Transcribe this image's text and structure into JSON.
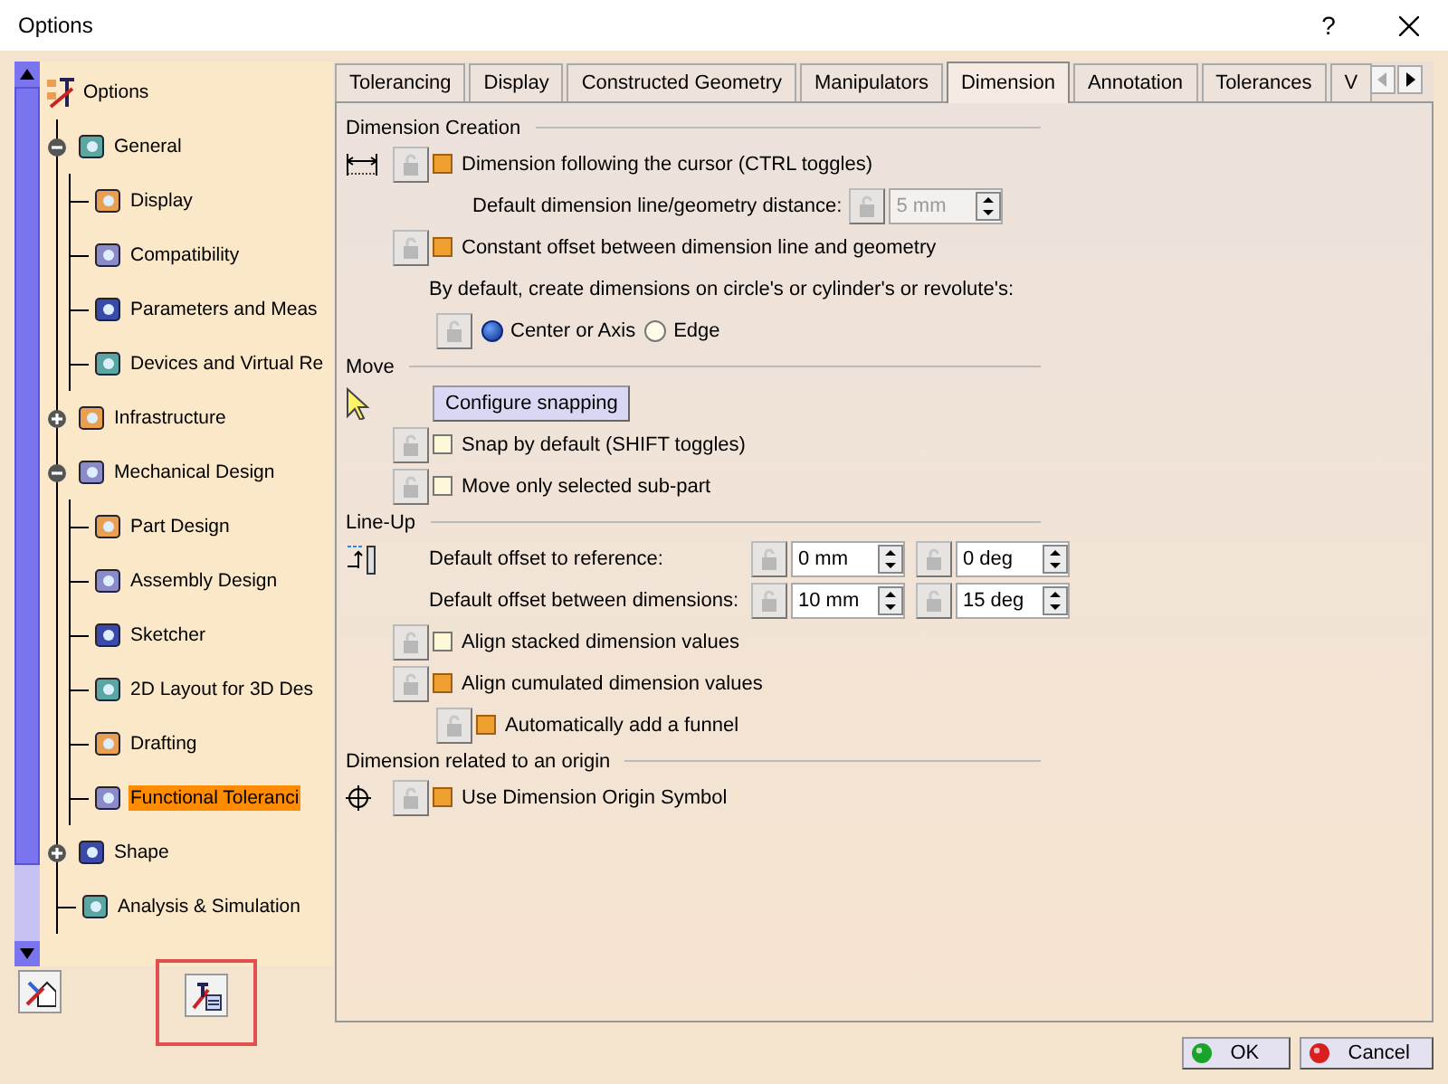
{
  "window": {
    "title": "Options",
    "help": "?"
  },
  "tree": {
    "label": "Options",
    "selected": false,
    "children": [
      {
        "label": "General",
        "expanded": true,
        "selected": false,
        "children": [
          {
            "label": "Display",
            "selected": false
          },
          {
            "label": "Compatibility",
            "selected": false
          },
          {
            "label": "Parameters and Meas",
            "selected": false
          },
          {
            "label": "Devices and Virtual Re",
            "selected": false
          }
        ]
      },
      {
        "label": "Infrastructure",
        "expanded": false,
        "selected": false
      },
      {
        "label": "Mechanical Design",
        "expanded": true,
        "selected": false,
        "children": [
          {
            "label": "Part Design",
            "selected": false
          },
          {
            "label": "Assembly Design",
            "selected": false
          },
          {
            "label": "Sketcher",
            "selected": false
          },
          {
            "label": "2D Layout for 3D Des",
            "selected": false
          },
          {
            "label": "Drafting",
            "selected": false
          },
          {
            "label": "Functional Toleranci",
            "selected": true
          }
        ]
      },
      {
        "label": "Shape",
        "expanded": false,
        "selected": false
      },
      {
        "label": "Analysis & Simulation",
        "selected": false
      }
    ]
  },
  "tabs": [
    {
      "label": "Tolerancing",
      "selected": false
    },
    {
      "label": "Display",
      "selected": false
    },
    {
      "label": "Constructed Geometry",
      "selected": false
    },
    {
      "label": "Manipulators",
      "selected": false
    },
    {
      "label": "Dimension",
      "selected": true
    },
    {
      "label": "Annotation",
      "selected": false
    },
    {
      "label": "Tolerances",
      "selected": false
    },
    {
      "label": "V",
      "selected": false
    }
  ],
  "sections": [
    {
      "title": "Dimension Creation",
      "rows": [
        {
          "kind": "checkbox",
          "label": "Dimension following the cursor (CTRL toggles)",
          "checked": true,
          "children": [
            {
              "kind": "field",
              "label": "Default dimension line/geometry distance:",
              "value": "5 mm",
              "disabled": true
            }
          ]
        },
        {
          "kind": "checkbox",
          "label": "Constant offset between dimension line and geometry",
          "checked": true,
          "children": [
            {
              "kind": "note",
              "label": "By default, create dimensions on circle's or cylinder's or revolute's:"
            },
            {
              "kind": "radios",
              "options": [
                {
                  "label": "Center or Axis",
                  "selected": true
                },
                {
                  "label": "Edge",
                  "selected": false
                }
              ]
            }
          ]
        }
      ]
    },
    {
      "title": "Move",
      "rows": [
        {
          "kind": "button",
          "label": "Configure snapping"
        },
        {
          "kind": "checkbox",
          "label": "Snap by default (SHIFT toggles)",
          "checked": false
        },
        {
          "kind": "checkbox",
          "label": "Move only selected sub-part",
          "checked": false
        }
      ]
    },
    {
      "title": "Line-Up",
      "rows": [
        {
          "kind": "pair",
          "label": "Default offset to reference:",
          "values": [
            "0 mm",
            "0 deg"
          ]
        },
        {
          "kind": "pair",
          "label": "Default offset between dimensions:",
          "values": [
            "10 mm",
            "15 deg"
          ]
        },
        {
          "kind": "checkbox",
          "label": "Align stacked dimension values",
          "checked": false
        },
        {
          "kind": "checkbox",
          "label": "Align cumulated dimension values",
          "checked": true,
          "children": [
            {
              "kind": "checkbox",
              "label": "Automatically add a funnel",
              "checked": true
            }
          ]
        }
      ]
    },
    {
      "title": "Dimension related to an origin",
      "rows": [
        {
          "kind": "checkbox",
          "label": "Use Dimension Origin Symbol",
          "checked": true
        }
      ]
    }
  ],
  "buttons": [
    {
      "label": "OK",
      "kind": "ok"
    },
    {
      "label": "Cancel",
      "kind": "cancel"
    }
  ]
}
